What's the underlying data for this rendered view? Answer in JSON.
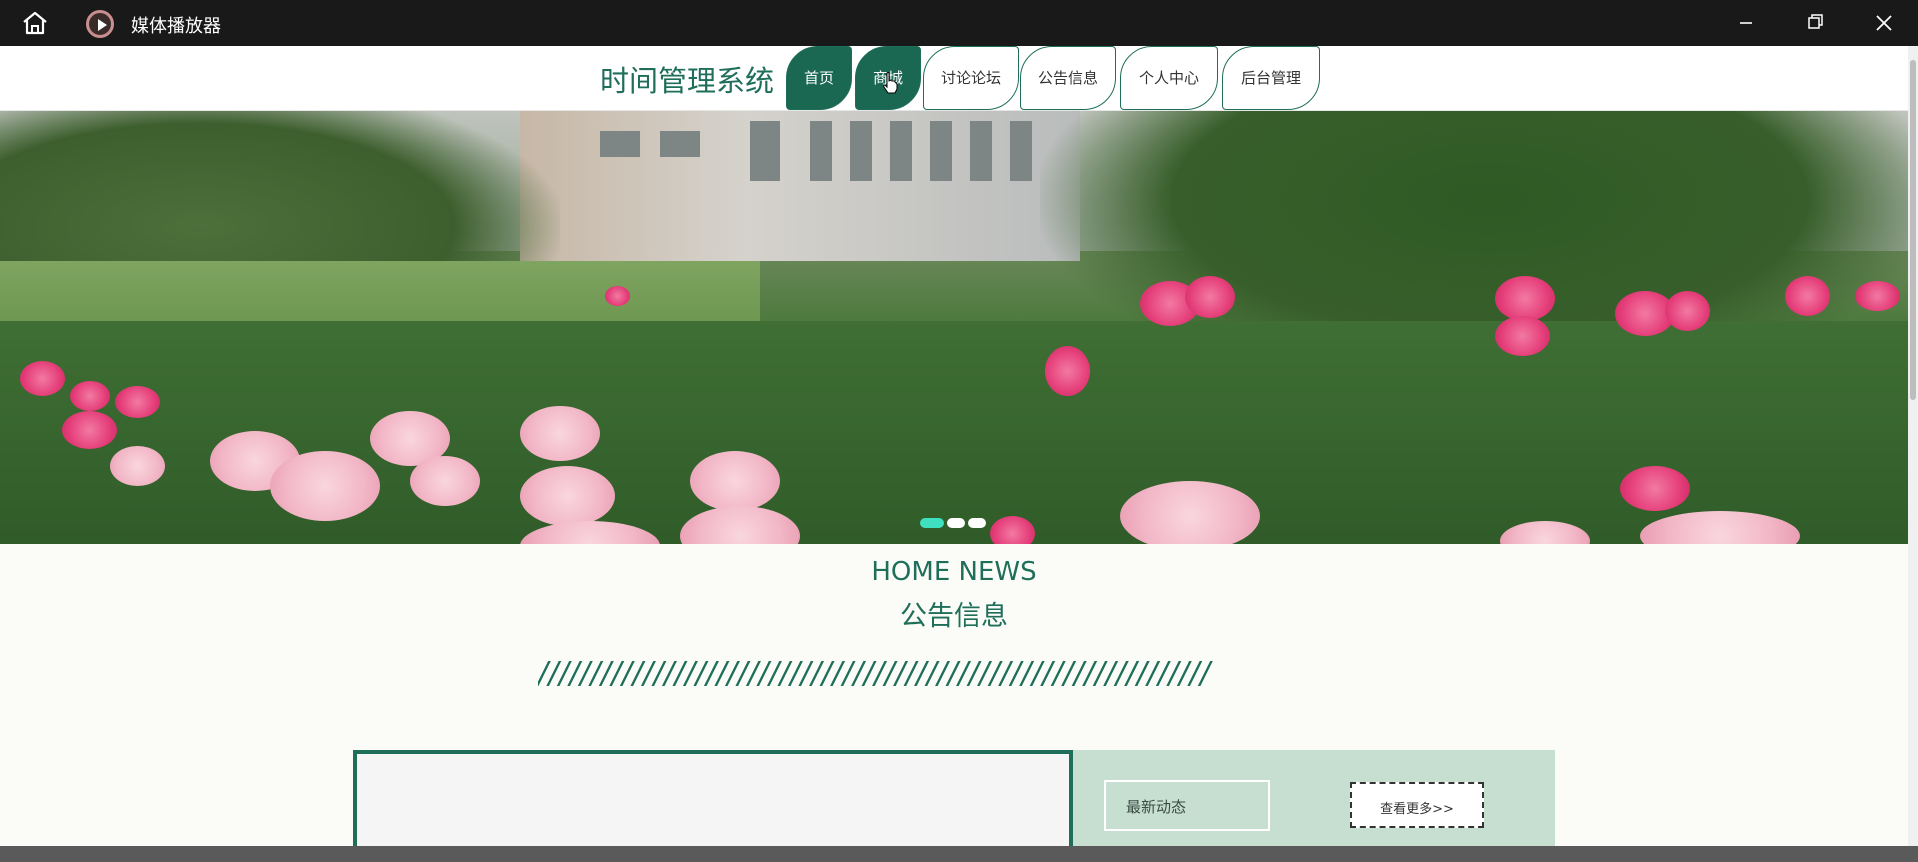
{
  "window": {
    "title": "媒体播放器",
    "home_icon": "home-icon",
    "app_icon": "media-player-icon",
    "controls": [
      "minimize-icon",
      "restore-icon",
      "close-icon"
    ]
  },
  "site": {
    "title": "时间管理系统"
  },
  "nav": {
    "items": [
      {
        "label": "首页",
        "active": true
      },
      {
        "label": "商城",
        "active": true
      },
      {
        "label": "讨论论坛",
        "active": false
      },
      {
        "label": "公告信息",
        "active": false
      },
      {
        "label": "个人中心",
        "active": false
      },
      {
        "label": "后台管理",
        "active": false
      }
    ]
  },
  "banner": {
    "slide_count": 3,
    "active_slide": 1
  },
  "news": {
    "heading_en": "HOME NEWS",
    "heading_cn": "公告信息",
    "divider": "////////////////////////////////////////////////////////////////",
    "latest_label": "最新动态",
    "more_button": "查看更多>>"
  },
  "colors": {
    "brand": "#1f6e5a",
    "nav_active": "#1a6752",
    "news_panel": "#c6dfd0"
  }
}
